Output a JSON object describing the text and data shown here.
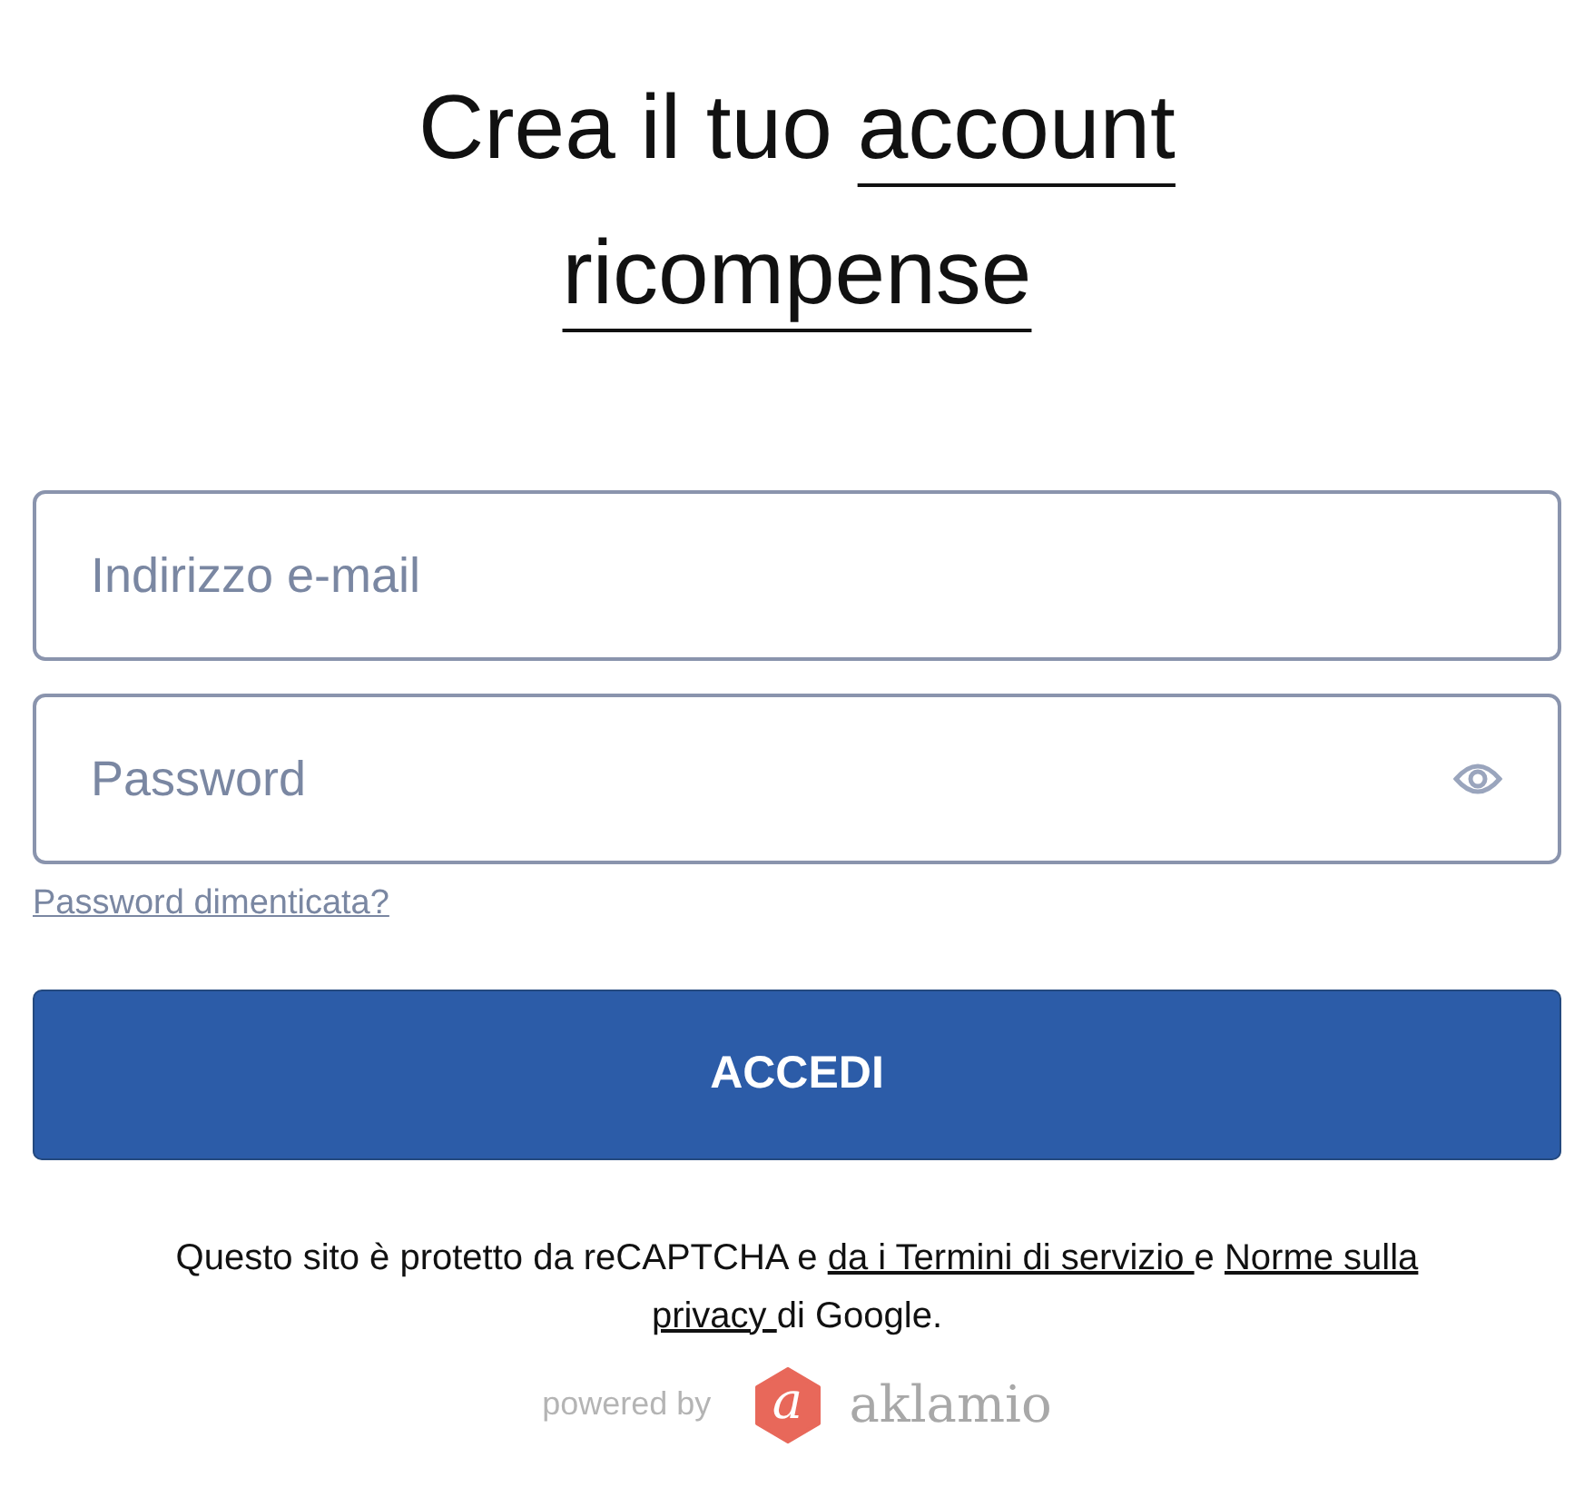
{
  "title": {
    "text": "Crea il tuo",
    "link_lines": [
      "account",
      "ricompense"
    ]
  },
  "fields": [
    {
      "placeholder": "Indirizzo e-mail",
      "kind": "text"
    },
    {
      "placeholder": "Password",
      "kind": "password"
    }
  ],
  "forgot_link": "Password dimenticata?",
  "submit": "ACCEDI",
  "notice_lines": [
    [
      {
        "kind": "text",
        "text": "Questo sito è protetto da reCAPTCHA e "
      },
      {
        "kind": "link",
        "text": "da i Termini di servizio "
      },
      {
        "kind": "text",
        "text": "e "
      },
      {
        "kind": "link",
        "text": "Norme sulla"
      }
    ],
    [
      {
        "kind": "link",
        "text": "privacy "
      },
      {
        "kind": "text",
        "text": "di Google."
      }
    ]
  ],
  "powered": {
    "label": "powered by",
    "logo_letter": "a",
    "brand": "aklamio"
  }
}
